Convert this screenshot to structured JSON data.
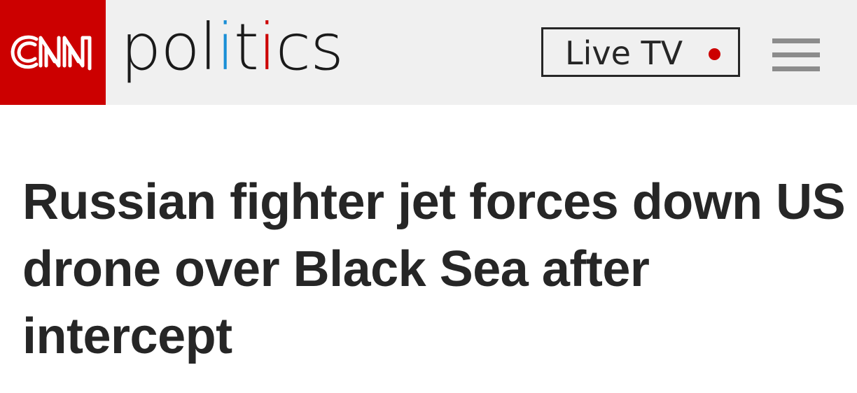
{
  "header": {
    "logo_text": "CNN",
    "section": {
      "letters": [
        {
          "ch": "p",
          "color": "#1a1a1a"
        },
        {
          "ch": "o",
          "color": "#1a1a1a"
        },
        {
          "ch": "l",
          "color": "#1a1a1a"
        },
        {
          "ch": "i",
          "color": "#1a8fd6"
        },
        {
          "ch": "t",
          "color": "#1a1a1a"
        },
        {
          "ch": "i",
          "color": "#cc0000"
        },
        {
          "ch": "c",
          "color": "#1a1a1a"
        },
        {
          "ch": "s",
          "color": "#1a1a1a"
        }
      ]
    },
    "live_tv_label": "Live TV",
    "live_indicator_color": "#cc0000",
    "menu_icon": "hamburger-menu-icon"
  },
  "colors": {
    "brand_red": "#cc0000",
    "header_bg": "#f0f0f0",
    "text": "#262626"
  },
  "article": {
    "headline": "Russian fighter jet forces down US drone over Black Sea after intercept"
  }
}
